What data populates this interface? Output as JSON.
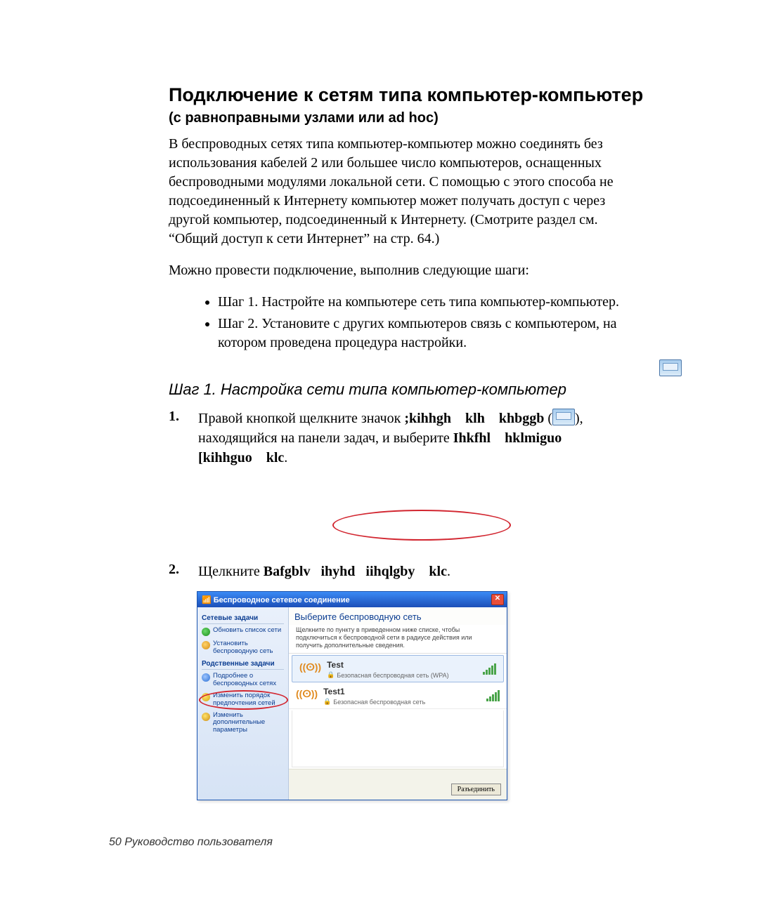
{
  "title": "Подключение к сетям типа компьютер-компьютер",
  "subtitle": "(с равноправными узлами или ad hoc)",
  "para1": "В беспроводных сетях типа компьютер-компьютер можно соединять без использования кабелей 2 или большее число компьютеров, оснащенных беспроводными модулями локальной сети. С помощью с этого способа не подсоединенный к Интернету компьютер может получать доступ с через другой компьютер, подсоединенный к Интернету. (Смотрите раздел см. “Общий доступ к сети Интернет” на стр. 64.)",
  "para2": "Можно провести подключение, выполнив следующие шаги:",
  "steps": {
    "s1": "Шаг 1. Настройте на компьютере сеть типа компьютер-компьютер.",
    "s2": "Шаг 2. Установите с других компьютеров связь с компьютером, на котором проведена процедура настройки."
  },
  "step_heading": "Шаг 1. Настройка сети типа компьютер-компьютер",
  "num1_prefix": "1.",
  "num1_text_a": "Правой кнопкой щелкните значок ",
  "num1_bold_a": ";kihhgh    klh    khbggb",
  "num1_text_b": " (",
  "num1_text_c": "), находящийся на панели задач, и выберите ",
  "num1_bold_b": "Ihkfhl    hklmiguo [kihhguo    klc",
  "num1_text_d": ".",
  "num2_prefix": "2.",
  "num2_text_a": "Щелкните ",
  "num2_bold_a": "Bafgblv   ihyhd   iihqlgby    klc",
  "num2_text_b": ".",
  "xp": {
    "title": "Беспроводное сетевое соединение",
    "side_header1": "Сетевые задачи",
    "side_link1": "Обновить список сети",
    "side_link2": "Установить беспроводную сеть",
    "side_header2": "Родственные задачи",
    "side_link3": "Подробнее о беспроводных сетях",
    "side_link4": "Изменить порядок предпочтения сетей",
    "side_link5": "Изменить дополнительные параметры",
    "main_header": "Выберите беспроводную сеть",
    "main_sub": "Щелкните по пункту в приведенном ниже списке, чтобы подключиться к беспроводной сети в радиусе действия или получить дополнительные сведения.",
    "net1_name": "Test",
    "net1_sub": "Безопасная беспроводная сеть (WPA)",
    "net2_name": "Test1",
    "net2_sub": "Безопасная беспроводная сеть",
    "button": "Разъединить"
  },
  "footer_page": "50",
  "footer_text": "Руководство пользователя"
}
